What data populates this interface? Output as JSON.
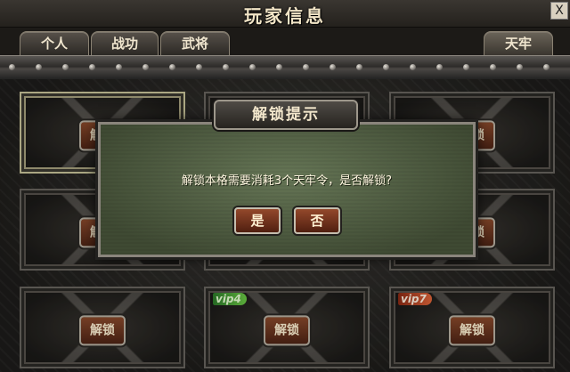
{
  "window": {
    "title": "玩家信息",
    "close_label": "X"
  },
  "tabs": [
    {
      "label": "个人"
    },
    {
      "label": "战功"
    },
    {
      "label": "武将"
    },
    {
      "label": "天牢"
    }
  ],
  "grid": {
    "unlock_label": "解锁",
    "vip_tags": [
      "vip4",
      "vip7"
    ]
  },
  "dialog": {
    "title": "解锁提示",
    "message": "解锁本格需要消耗3个天牢令，是否解锁?",
    "yes_label": "是",
    "no_label": "否"
  }
}
